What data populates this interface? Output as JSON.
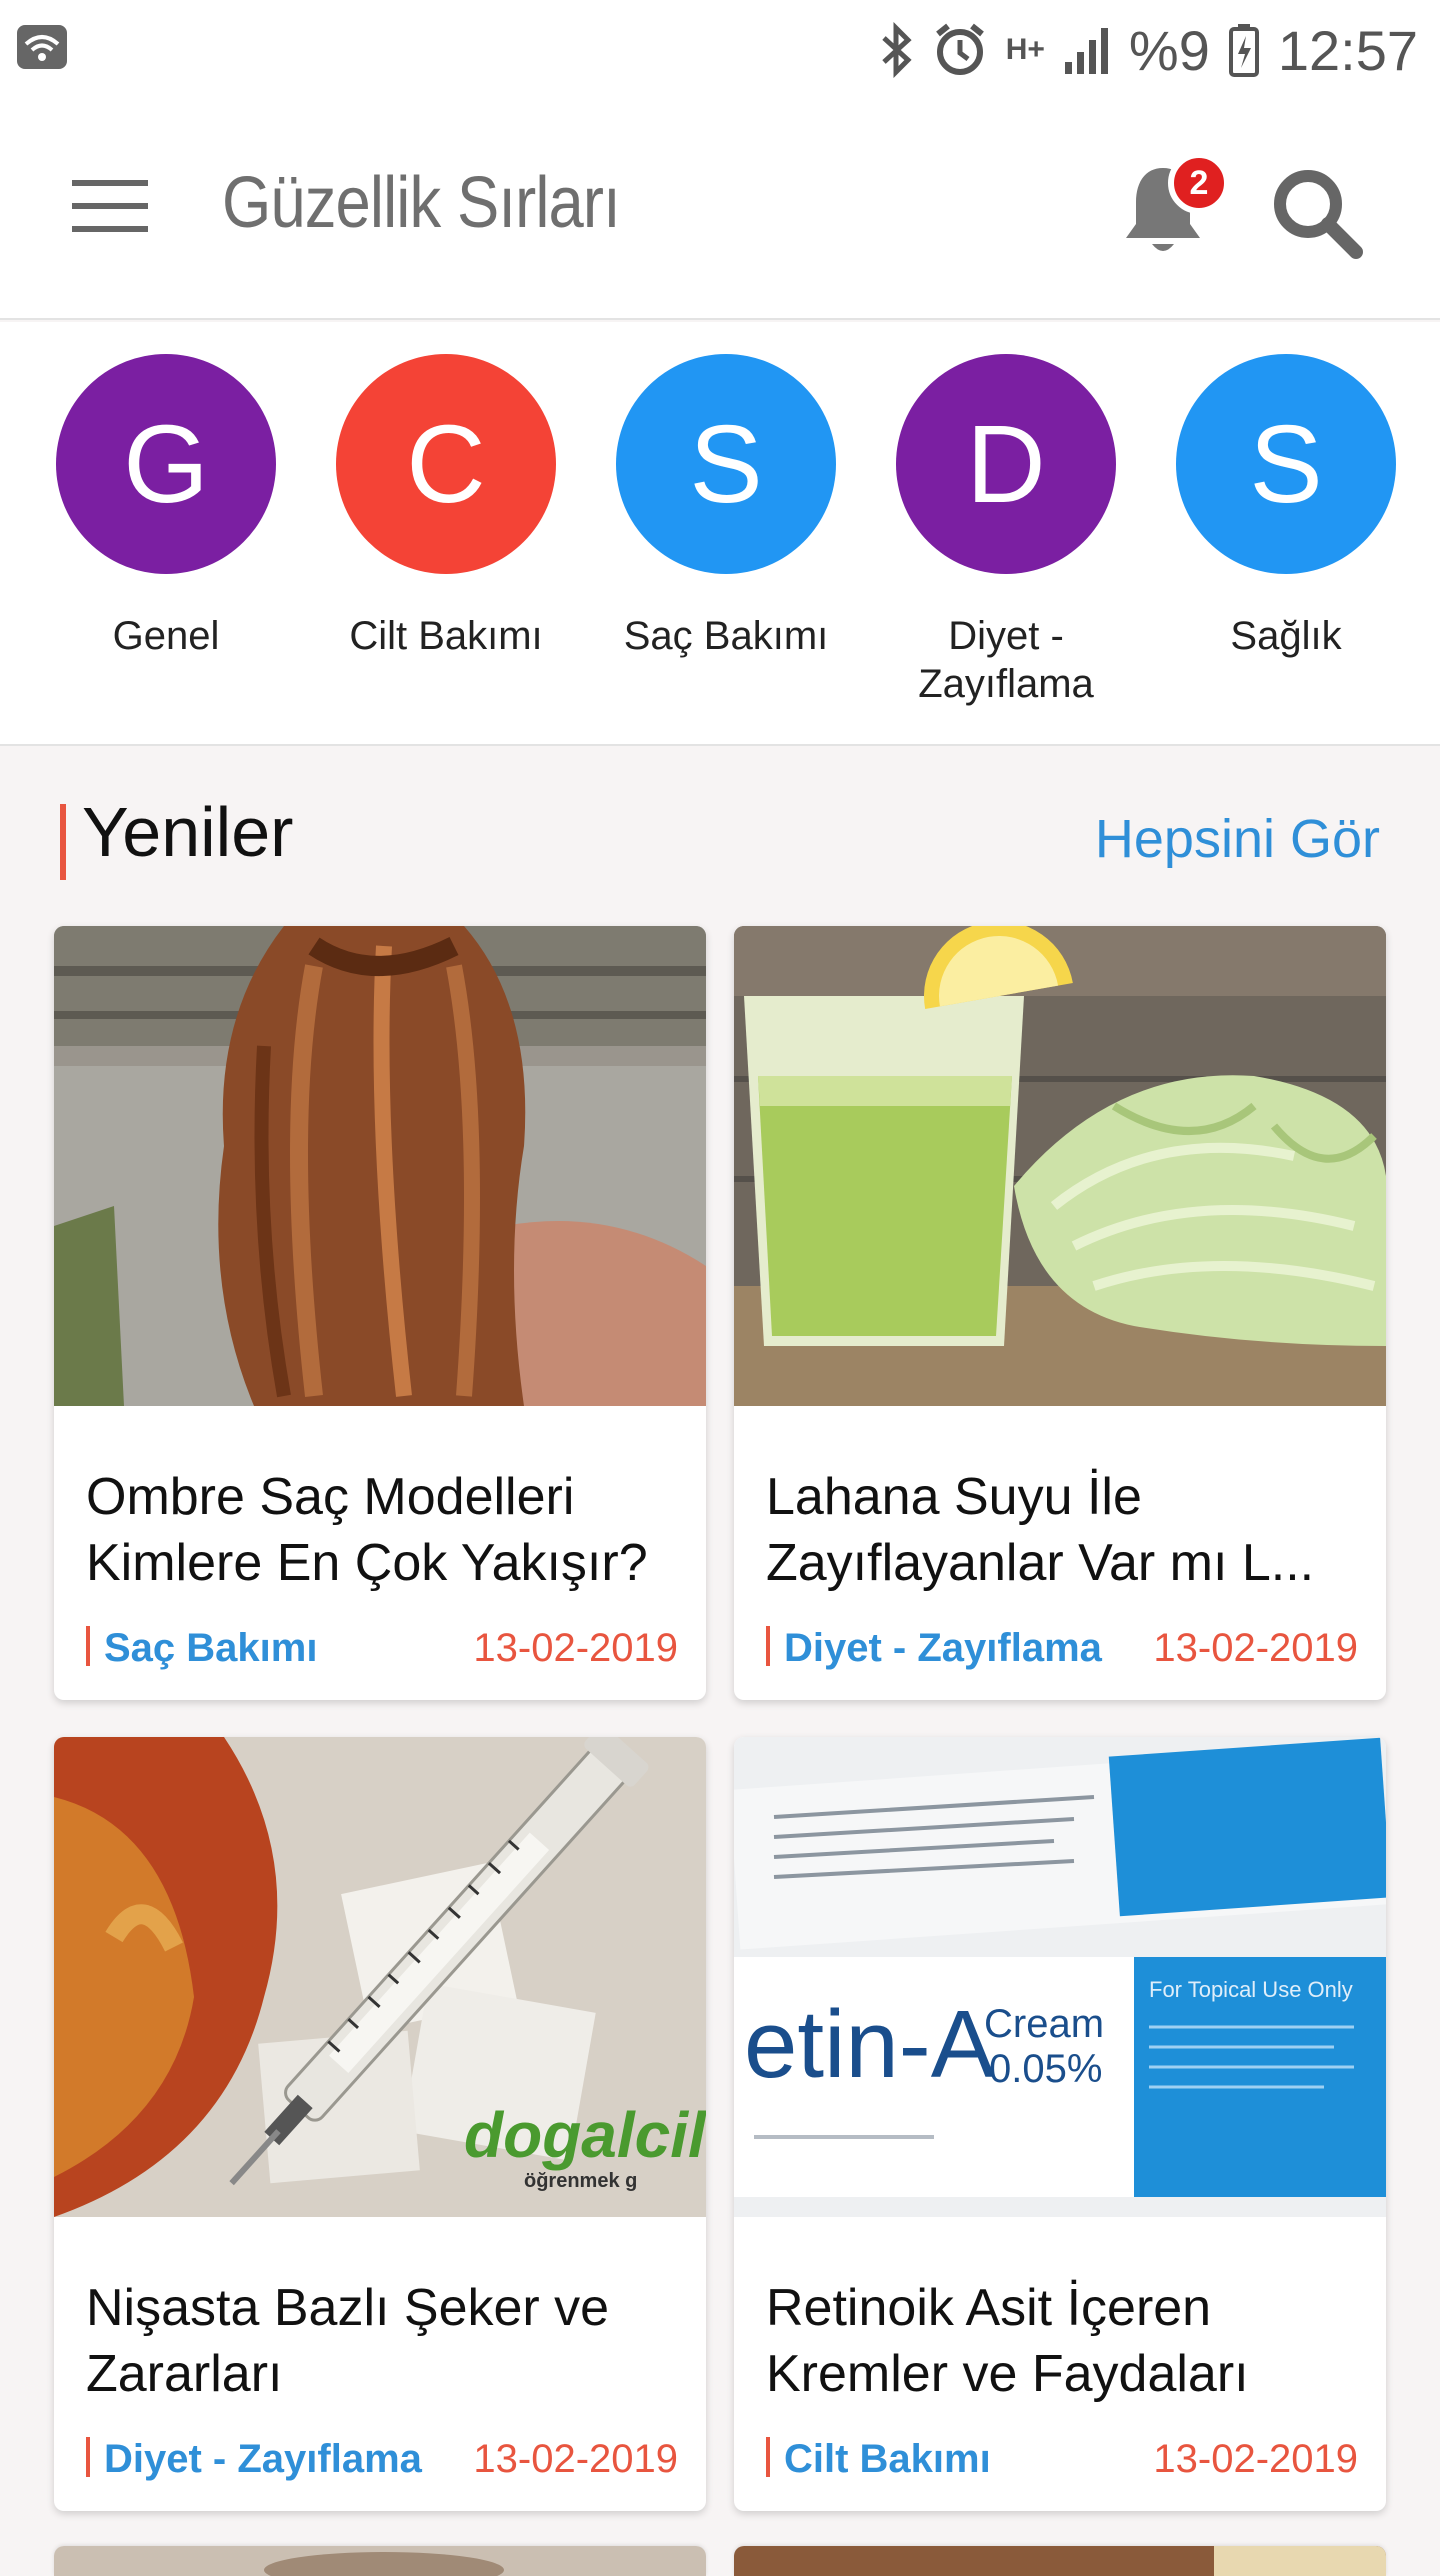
{
  "status_bar": {
    "network": "H+",
    "battery": "%9",
    "time": "12:57"
  },
  "app_bar": {
    "title": "Güzellik Sırları",
    "notification_count": "2"
  },
  "categories": [
    {
      "letter": "G",
      "label": "Genel",
      "color": "#7b1fa2"
    },
    {
      "letter": "C",
      "label": "Cilt Bakımı",
      "color": "#f44336"
    },
    {
      "letter": "S",
      "label": "Saç Bakımı",
      "color": "#2196f3"
    },
    {
      "letter": "D",
      "label": "Diyet - Zayıflama",
      "color": "#7b1fa2"
    },
    {
      "letter": "S",
      "label": "Sağlık",
      "color": "#2196f3"
    }
  ],
  "section": {
    "title": "Yeniler",
    "see_all": "Hepsini Gör"
  },
  "articles": [
    {
      "title": "Ombre Saç Modelleri Kimlere En Çok Yakışır?",
      "category": "Saç Bakımı",
      "date": "13-02-2019",
      "image": "hair-photo"
    },
    {
      "title": "Lahana Suyu İle Zayıflayanlar Var mı L...",
      "category": "Diyet - Zayıflama",
      "date": "13-02-2019",
      "image": "cabbage-juice-photo"
    },
    {
      "title": "Nişasta Bazlı Şeker ve Zararları",
      "category": "Diyet - Zayıflama",
      "date": "13-02-2019",
      "image": "syringe-sugar-photo"
    },
    {
      "title": "Retinoik Asit İçeren Kremler ve Faydaları",
      "category": "Cilt Bakımı",
      "date": "13-02-2019",
      "image": "cream-tube-photo"
    }
  ],
  "images": {
    "watermark": "dogalcilt",
    "watermark_sub": "öğrenmek g",
    "cream_brand": "etin-A",
    "cream_word": "Cream",
    "cream_percent": "0.05%",
    "cream_topical": "For Topical Use Only"
  },
  "colors": {
    "accent": "#e8553f",
    "link": "#2f8fd8"
  }
}
